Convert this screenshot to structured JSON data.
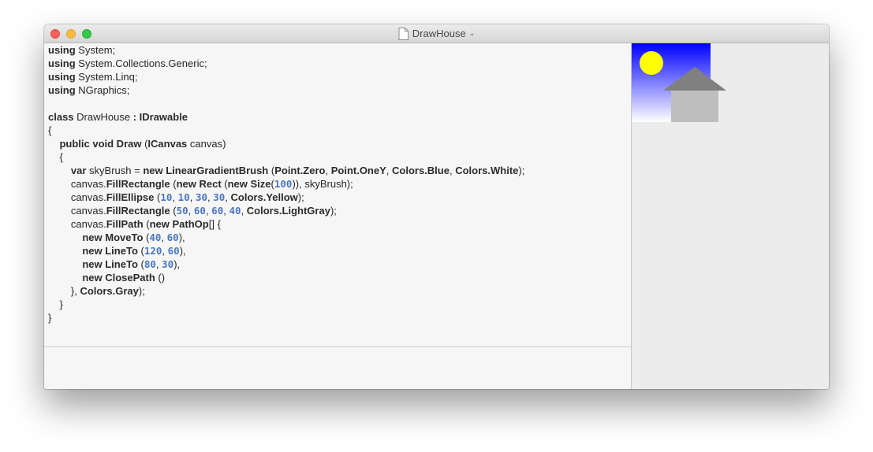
{
  "window": {
    "title": "DrawHouse",
    "title_chevron": "⌄",
    "icons": {
      "close": "close-icon",
      "minimize": "minimize-icon",
      "zoom": "zoom-icon",
      "document": "document-icon"
    }
  },
  "code": {
    "lines": [
      [
        [
          "k",
          "using"
        ],
        [
          "t",
          " System;"
        ]
      ],
      [
        [
          "k",
          "using"
        ],
        [
          "t",
          " System.Collections.Generic;"
        ]
      ],
      [
        [
          "k",
          "using"
        ],
        [
          "t",
          " System.Linq;"
        ]
      ],
      [
        [
          "k",
          "using"
        ],
        [
          "t",
          " NGraphics;"
        ]
      ],
      [],
      [
        [
          "k",
          "class"
        ],
        [
          "t",
          " DrawHouse "
        ],
        [
          "k",
          ": IDrawable"
        ]
      ],
      [
        [
          "t",
          "{"
        ]
      ],
      [
        [
          "t",
          "    "
        ],
        [
          "k",
          "public void Draw"
        ],
        [
          "t",
          " ("
        ],
        [
          "k",
          "ICanvas"
        ],
        [
          "t",
          " canvas)"
        ]
      ],
      [
        [
          "t",
          "    {"
        ]
      ],
      [
        [
          "t",
          "        "
        ],
        [
          "k",
          "var"
        ],
        [
          "t",
          " skyBrush = "
        ],
        [
          "k",
          "new LinearGradientBrush"
        ],
        [
          "t",
          " ("
        ],
        [
          "k",
          "Point.Zero"
        ],
        [
          "t",
          ", "
        ],
        [
          "k",
          "Point.OneY"
        ],
        [
          "t",
          ", "
        ],
        [
          "k",
          "Colors.Blue"
        ],
        [
          "t",
          ", "
        ],
        [
          "k",
          "Colors.White"
        ],
        [
          "t",
          ");"
        ]
      ],
      [
        [
          "t",
          "        canvas."
        ],
        [
          "k",
          "FillRectangle"
        ],
        [
          "t",
          " ("
        ],
        [
          "k",
          "new Rect"
        ],
        [
          "t",
          " ("
        ],
        [
          "k",
          "new Size"
        ],
        [
          "t",
          "("
        ],
        [
          "n",
          "100"
        ],
        [
          "t",
          "))"
        ],
        [
          "t",
          ", skyBrush);"
        ]
      ],
      [
        [
          "t",
          "        canvas."
        ],
        [
          "k",
          "FillEllipse"
        ],
        [
          "t",
          " ("
        ],
        [
          "n",
          "10"
        ],
        [
          "t",
          ", "
        ],
        [
          "n",
          "10"
        ],
        [
          "t",
          ", "
        ],
        [
          "n",
          "30"
        ],
        [
          "t",
          ", "
        ],
        [
          "n",
          "30"
        ],
        [
          "t",
          ", "
        ],
        [
          "k",
          "Colors.Yellow"
        ],
        [
          "t",
          ");"
        ]
      ],
      [
        [
          "t",
          "        canvas."
        ],
        [
          "k",
          "FillRectangle"
        ],
        [
          "t",
          " ("
        ],
        [
          "n",
          "50"
        ],
        [
          "t",
          ", "
        ],
        [
          "n",
          "60"
        ],
        [
          "t",
          ", "
        ],
        [
          "n",
          "60"
        ],
        [
          "t",
          ", "
        ],
        [
          "n",
          "40"
        ],
        [
          "t",
          ", "
        ],
        [
          "k",
          "Colors.LightGray"
        ],
        [
          "t",
          ");"
        ]
      ],
      [
        [
          "t",
          "        canvas."
        ],
        [
          "k",
          "FillPath"
        ],
        [
          "t",
          " ("
        ],
        [
          "k",
          "new PathOp"
        ],
        [
          "t",
          "[] {"
        ]
      ],
      [
        [
          "t",
          "            "
        ],
        [
          "k",
          "new MoveTo"
        ],
        [
          "t",
          " ("
        ],
        [
          "n",
          "40"
        ],
        [
          "t",
          ", "
        ],
        [
          "n",
          "60"
        ],
        [
          "t",
          "),"
        ]
      ],
      [
        [
          "t",
          "            "
        ],
        [
          "k",
          "new LineTo"
        ],
        [
          "t",
          " ("
        ],
        [
          "n",
          "120"
        ],
        [
          "t",
          ", "
        ],
        [
          "n",
          "60"
        ],
        [
          "t",
          "),"
        ]
      ],
      [
        [
          "t",
          "            "
        ],
        [
          "k",
          "new LineTo"
        ],
        [
          "t",
          " ("
        ],
        [
          "n",
          "80"
        ],
        [
          "t",
          ", "
        ],
        [
          "n",
          "30"
        ],
        [
          "t",
          "),"
        ]
      ],
      [
        [
          "t",
          "            "
        ],
        [
          "k",
          "new ClosePath"
        ],
        [
          "t",
          " ()"
        ]
      ],
      [
        [
          "t",
          "        }, "
        ],
        [
          "k",
          "Colors.Gray"
        ],
        [
          "t",
          ");"
        ]
      ],
      [
        [
          "t",
          "    }"
        ]
      ],
      [
        [
          "t",
          "}"
        ]
      ]
    ]
  },
  "preview": {
    "sky_top_color": "#0000ff",
    "sky_bottom_color": "#ffffff",
    "sun_color": "#ffff00",
    "wall_color": "#bebebe",
    "roof_color": "#808080"
  }
}
